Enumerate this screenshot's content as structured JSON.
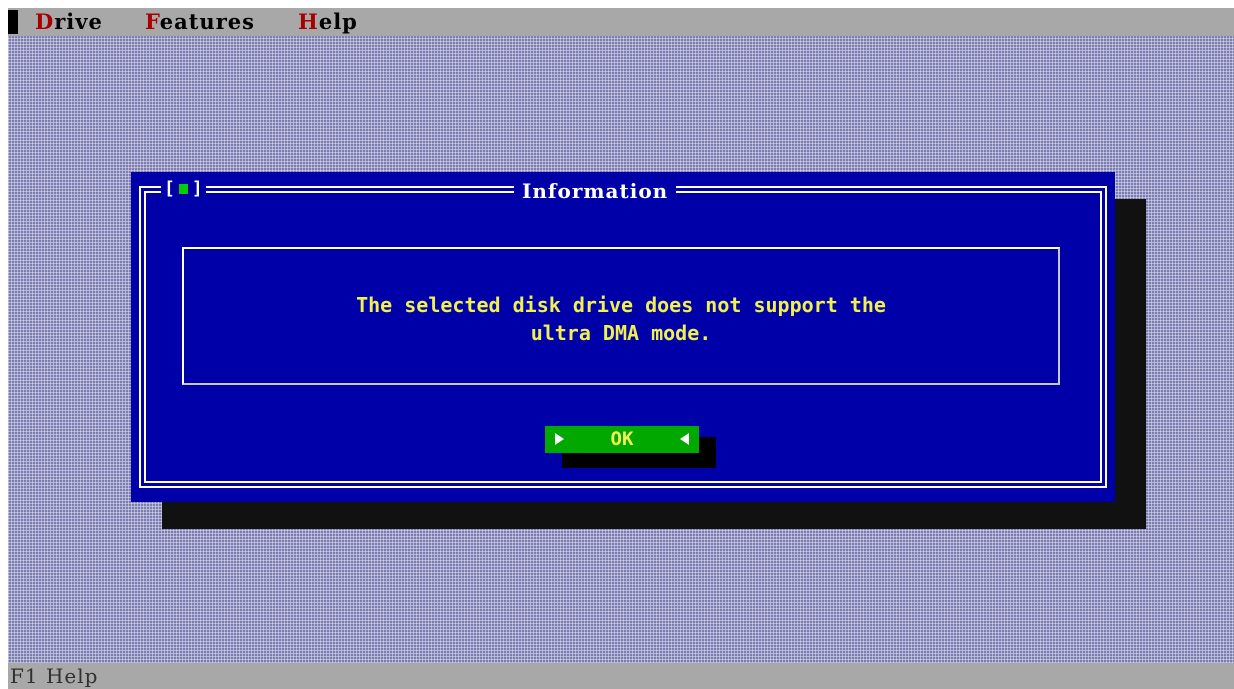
{
  "menubar": {
    "items": [
      {
        "hotkey": "D",
        "rest": "rive"
      },
      {
        "hotkey": "F",
        "rest": "eatures"
      },
      {
        "hotkey": "H",
        "rest": "elp"
      }
    ]
  },
  "dialog": {
    "close_box": {
      "left": "[",
      "right": "]"
    },
    "title": "Information",
    "message": "The selected disk drive does not support the\nultra DMA mode.",
    "ok_label": "OK"
  },
  "statusbar": {
    "text": "F1 Help"
  },
  "colors": {
    "screen_gray": "#a8a8a8",
    "desktop_blue": "#7c7cb4",
    "dialog_blue": "#0000a8",
    "menu_hotkey_red": "#a80000",
    "message_yellow": "#f0f050",
    "button_green": "#00a800"
  }
}
